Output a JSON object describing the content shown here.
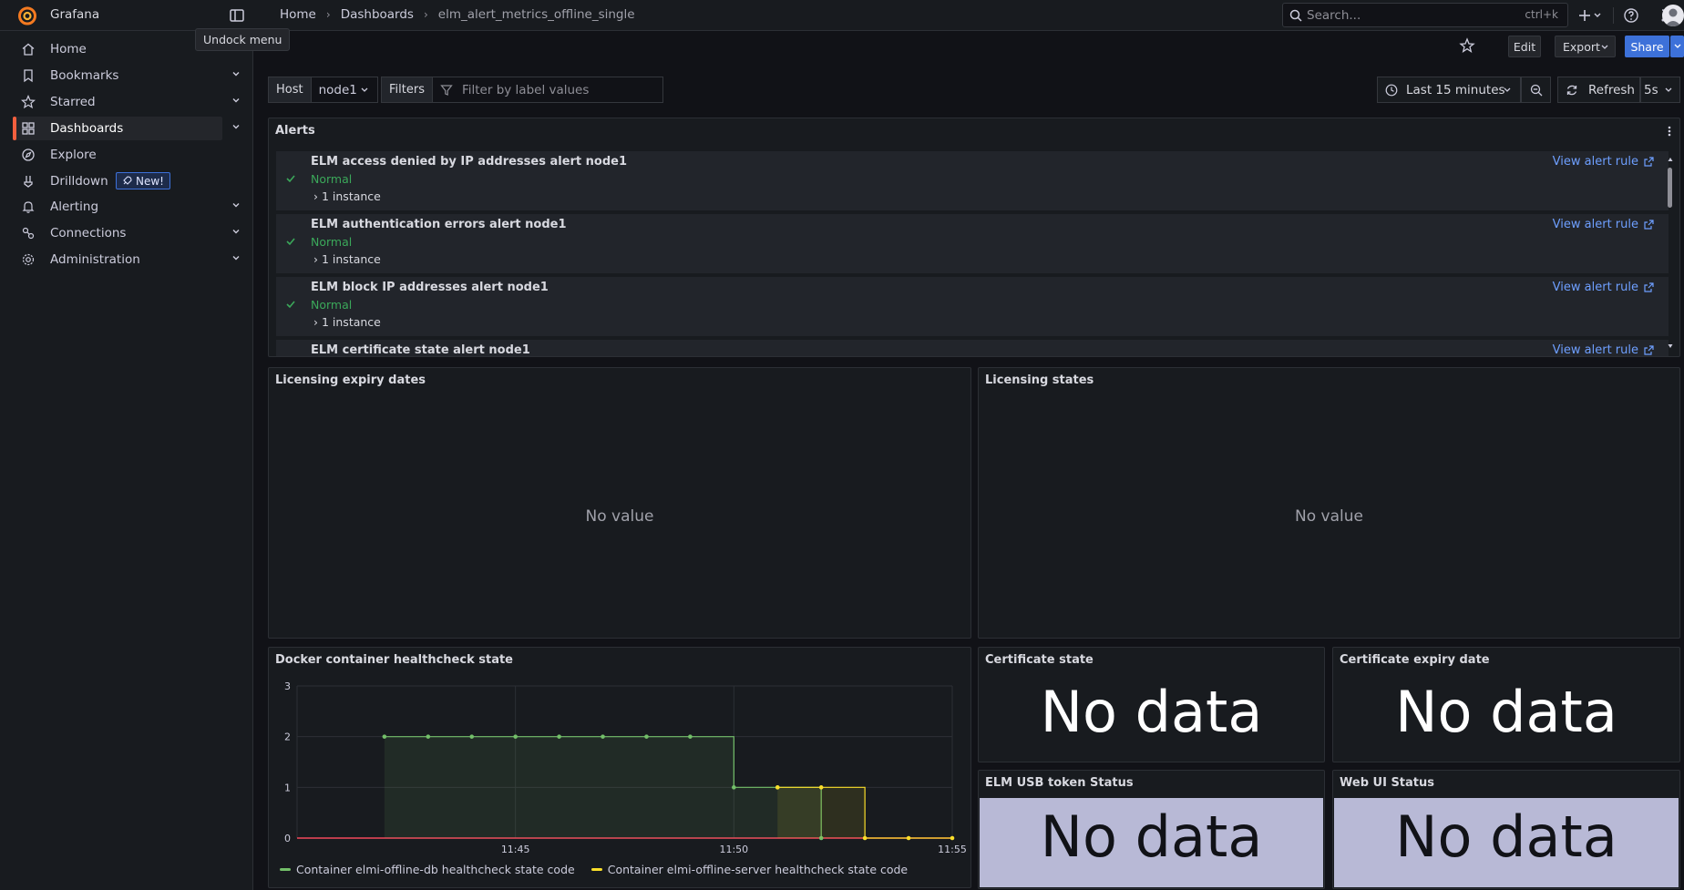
{
  "app": {
    "brand": "Grafana",
    "dock_tooltip": "Undock menu"
  },
  "breadcrumb": [
    "Home",
    "Dashboards",
    "elm_alert_metrics_offline_single"
  ],
  "search": {
    "placeholder": "Search...",
    "shortcut": "ctrl+k"
  },
  "toolbar": {
    "edit": "Edit",
    "export": "Export",
    "share": "Share"
  },
  "sidebar": {
    "items": [
      {
        "label": "Home",
        "icon": "home-icon",
        "has_chevron": false
      },
      {
        "label": "Bookmarks",
        "icon": "bookmark-icon",
        "has_chevron": true
      },
      {
        "label": "Starred",
        "icon": "star-icon",
        "has_chevron": true
      },
      {
        "label": "Dashboards",
        "icon": "apps-icon",
        "has_chevron": true,
        "active": true
      },
      {
        "label": "Explore",
        "icon": "compass-icon",
        "has_chevron": false
      },
      {
        "label": "Drilldown",
        "icon": "drilldown-icon",
        "has_chevron": false,
        "badge": "New!"
      },
      {
        "label": "Alerting",
        "icon": "bell-icon",
        "has_chevron": true
      },
      {
        "label": "Connections",
        "icon": "connections-icon",
        "has_chevron": true
      },
      {
        "label": "Administration",
        "icon": "cog-icon",
        "has_chevron": true
      }
    ]
  },
  "variables": {
    "host_label": "Host",
    "host_value": "node1",
    "filters_label": "Filters",
    "filters_placeholder": "Filter by label values"
  },
  "time": {
    "range": "Last 15 minutes",
    "refresh": "Refresh",
    "interval": "5s"
  },
  "panels": {
    "alerts": {
      "title": "Alerts",
      "rows": [
        {
          "name": "ELM access denied by IP addresses alert node1",
          "state": "Normal",
          "instances": "1 instance",
          "link": "View alert rule"
        },
        {
          "name": "ELM authentication errors alert node1",
          "state": "Normal",
          "instances": "1 instance",
          "link": "View alert rule"
        },
        {
          "name": "ELM block IP addresses alert node1",
          "state": "Normal",
          "instances": "1 instance",
          "link": "View alert rule"
        },
        {
          "name": "ELM certificate state alert node1",
          "state": "",
          "instances": "",
          "link": "View alert rule"
        }
      ]
    },
    "licensing_expiry": {
      "title": "Licensing expiry dates",
      "value": "No value"
    },
    "licensing_states": {
      "title": "Licensing states",
      "value": "No value"
    },
    "docker": {
      "title": "Docker container healthcheck state"
    },
    "certificate_state": {
      "title": "Certificate state",
      "value": "No data"
    },
    "certificate_expiry": {
      "title": "Certificate expiry date",
      "value": "No data"
    },
    "usb_token": {
      "title": "ELM USB token Status",
      "value": "No data"
    },
    "web_ui": {
      "title": "Web UI Status",
      "value": "No data"
    }
  },
  "colors": {
    "accent": "#f55f3e",
    "link": "#6e9fff",
    "ok": "#3ba85a",
    "stat_bg": "#b8b9d6",
    "primary": "#3d71d9"
  },
  "chart_data": {
    "type": "line",
    "title": "Docker container healthcheck state",
    "xlabel": "",
    "ylabel": "",
    "x_ticks": [
      "11:45",
      "11:50",
      "11:55"
    ],
    "y_ticks": [
      0,
      1,
      2,
      3
    ],
    "ylim": [
      0,
      3
    ],
    "x_range_minutes": [
      0,
      15
    ],
    "line_style": "step",
    "series": [
      {
        "name": "Container elmi-offline-db healthcheck state code",
        "color": "#73bf69",
        "points": [
          [
            2.0,
            2
          ],
          [
            3.0,
            2
          ],
          [
            4.0,
            2
          ],
          [
            5.0,
            2
          ],
          [
            6.0,
            2
          ],
          [
            7.0,
            2
          ],
          [
            8.0,
            2
          ],
          [
            9.0,
            2
          ],
          [
            10.0,
            1
          ],
          [
            11.0,
            1
          ],
          [
            12.0,
            0
          ]
        ]
      },
      {
        "name": "Container elmi-offline-server healthcheck state code",
        "color": "#fade2a",
        "points": [
          [
            11.0,
            1
          ],
          [
            12.0,
            1
          ],
          [
            13.0,
            0
          ],
          [
            14.0,
            0
          ],
          [
            15.0,
            0
          ]
        ]
      }
    ],
    "threshold": {
      "value": 0,
      "color": "#f2495c"
    },
    "legend_position": "bottom"
  }
}
